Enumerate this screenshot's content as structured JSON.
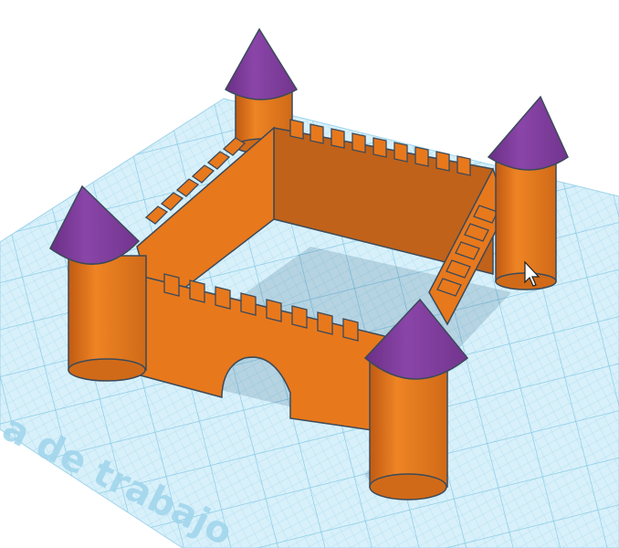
{
  "workplane": {
    "label": "a de trabajo",
    "grid_color": "#8fcfe8",
    "plane_color": "#d8f0fa"
  },
  "model": {
    "name": "castle",
    "wall_color": "#e8781c",
    "wall_shade_color": "#c0621a",
    "roof_color": "#7b3a96",
    "outline_color": "#3b4a5a"
  },
  "cursor": {
    "icon": "arrow-cursor-icon"
  }
}
